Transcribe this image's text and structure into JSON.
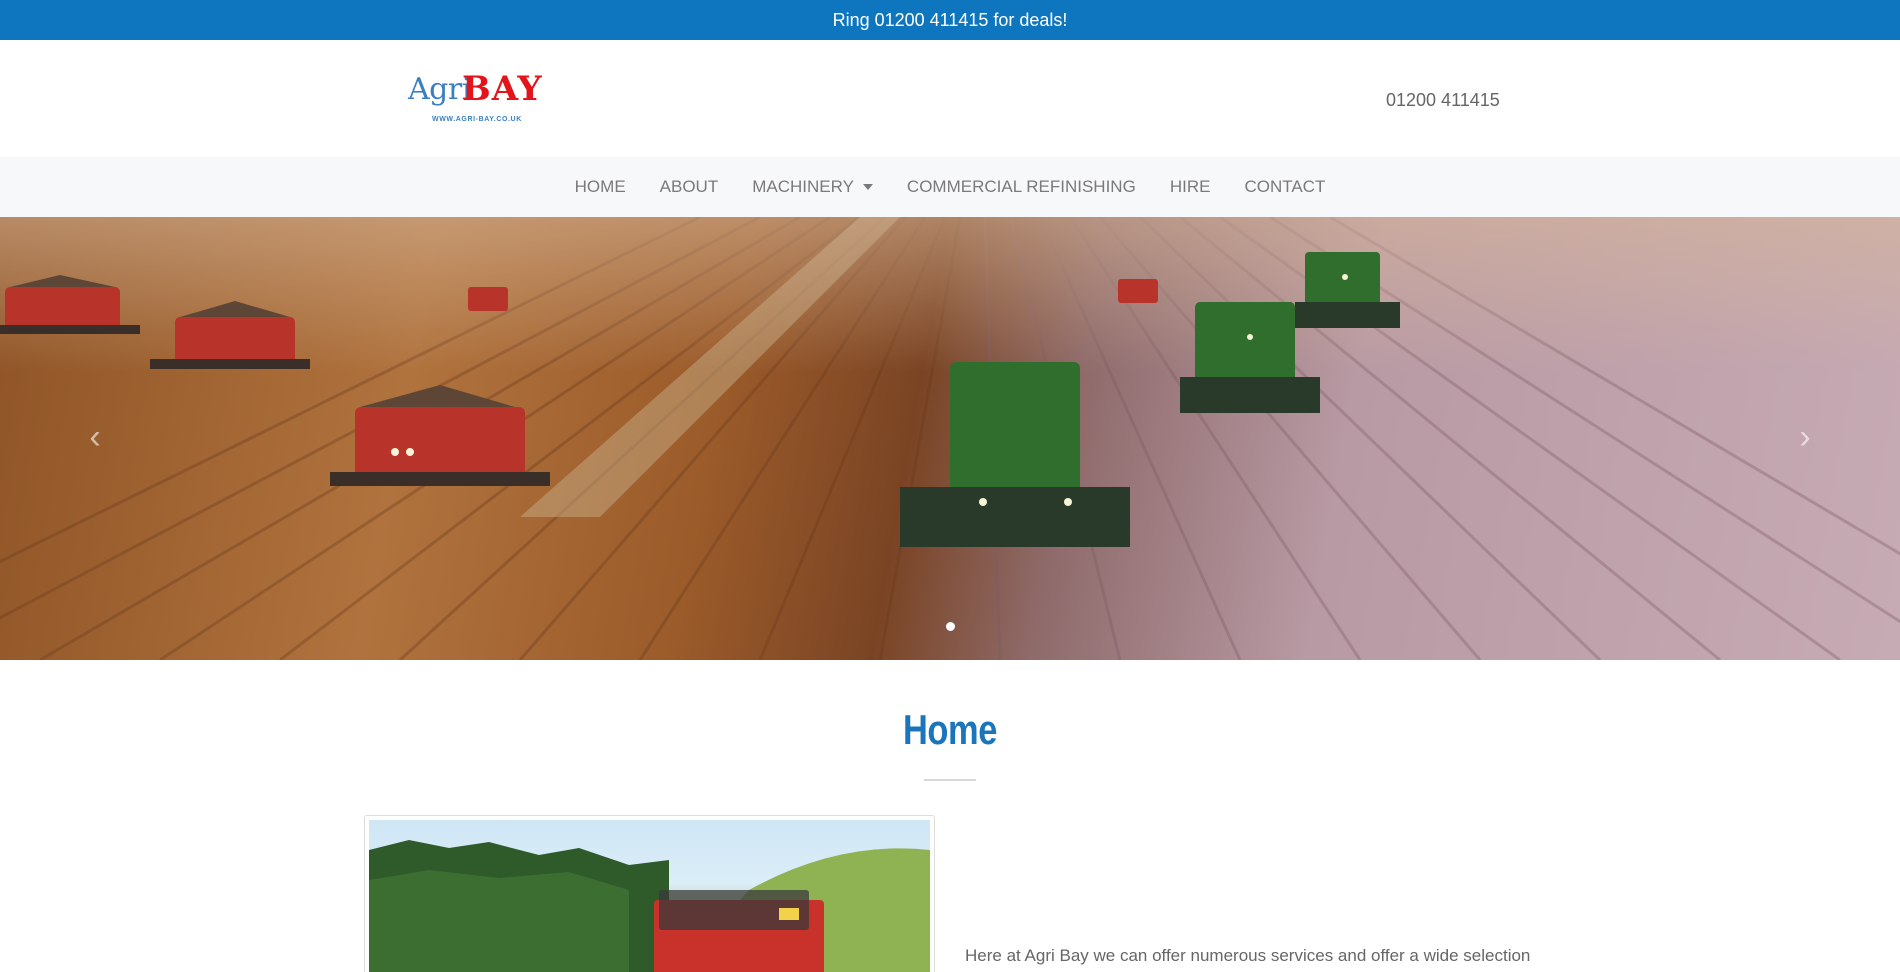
{
  "topbar": {
    "text": "Ring 01200 411415 for deals!"
  },
  "header": {
    "logo": {
      "agri": "Agri",
      "bay": "BAY",
      "url": "WWW.AGRI-BAY.CO.UK"
    },
    "phone": "01200 411415"
  },
  "nav": {
    "items": [
      {
        "label": "HOME"
      },
      {
        "label": "ABOUT"
      },
      {
        "label": "MACHINERY"
      },
      {
        "label": "COMMERCIAL REFINISHING"
      },
      {
        "label": "HIRE"
      },
      {
        "label": "CONTACT"
      }
    ]
  },
  "hero": {
    "prev_icon": "chevron-left-icon",
    "next_icon": "chevron-right-icon",
    "slides": 1,
    "active_slide": 1
  },
  "main": {
    "title": "Home",
    "intro": "Here at Agri Bay we can offer numerous services and offer a wide selection"
  },
  "colors": {
    "brand_blue": "#0d76be",
    "title_blue": "#1b75bb",
    "logo_red": "#e3141c",
    "nav_bg": "#f7f8fa"
  }
}
